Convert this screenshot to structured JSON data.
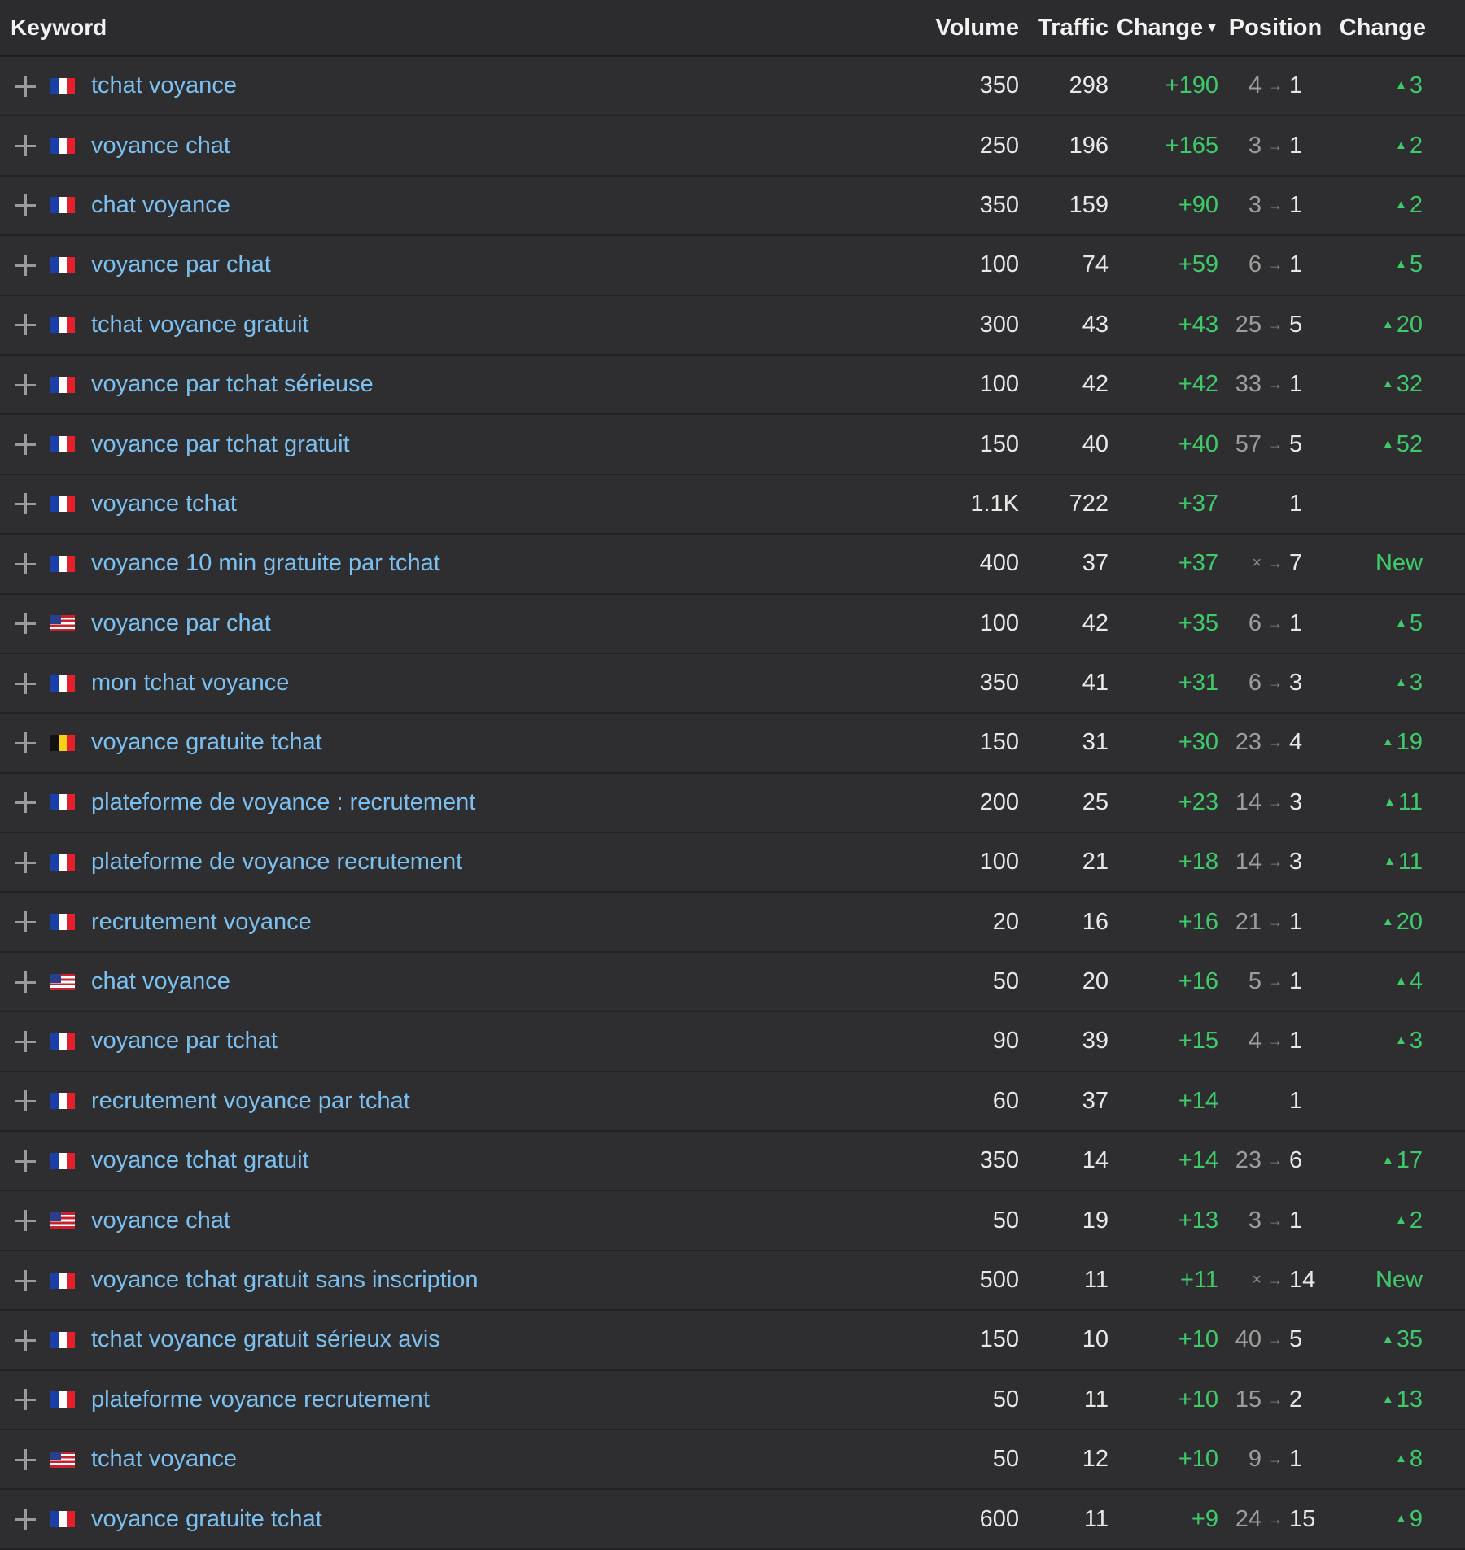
{
  "header": {
    "keyword": "Keyword",
    "volume": "Volume",
    "traffic": "Traffic",
    "change": "Change",
    "position": "Position",
    "position_change": "Change"
  },
  "rows": [
    {
      "flag": "fr",
      "keyword": "tchat voyance",
      "volume": "350",
      "traffic": "298",
      "change": "+190",
      "pos_from": "4",
      "pos_to": "1",
      "pos_change": "3"
    },
    {
      "flag": "fr",
      "keyword": "voyance chat",
      "volume": "250",
      "traffic": "196",
      "change": "+165",
      "pos_from": "3",
      "pos_to": "1",
      "pos_change": "2"
    },
    {
      "flag": "fr",
      "keyword": "chat voyance",
      "volume": "350",
      "traffic": "159",
      "change": "+90",
      "pos_from": "3",
      "pos_to": "1",
      "pos_change": "2"
    },
    {
      "flag": "fr",
      "keyword": "voyance par chat",
      "volume": "100",
      "traffic": "74",
      "change": "+59",
      "pos_from": "6",
      "pos_to": "1",
      "pos_change": "5"
    },
    {
      "flag": "fr",
      "keyword": "tchat voyance gratuit",
      "volume": "300",
      "traffic": "43",
      "change": "+43",
      "pos_from": "25",
      "pos_to": "5",
      "pos_change": "20"
    },
    {
      "flag": "fr",
      "keyword": "voyance par tchat sérieuse",
      "volume": "100",
      "traffic": "42",
      "change": "+42",
      "pos_from": "33",
      "pos_to": "1",
      "pos_change": "32"
    },
    {
      "flag": "fr",
      "keyword": "voyance par tchat gratuit",
      "volume": "150",
      "traffic": "40",
      "change": "+40",
      "pos_from": "57",
      "pos_to": "5",
      "pos_change": "52"
    },
    {
      "flag": "fr",
      "keyword": "voyance tchat",
      "volume": "1.1K",
      "traffic": "722",
      "change": "+37",
      "pos_from": "",
      "pos_to": "1",
      "pos_change": ""
    },
    {
      "flag": "fr",
      "keyword": "voyance 10 min gratuite par tchat",
      "volume": "400",
      "traffic": "37",
      "change": "+37",
      "pos_from": "×",
      "pos_to": "7",
      "pos_change": "New"
    },
    {
      "flag": "us",
      "keyword": "voyance par chat",
      "volume": "100",
      "traffic": "42",
      "change": "+35",
      "pos_from": "6",
      "pos_to": "1",
      "pos_change": "5"
    },
    {
      "flag": "fr",
      "keyword": "mon tchat voyance",
      "volume": "350",
      "traffic": "41",
      "change": "+31",
      "pos_from": "6",
      "pos_to": "3",
      "pos_change": "3"
    },
    {
      "flag": "be",
      "keyword": "voyance gratuite tchat",
      "volume": "150",
      "traffic": "31",
      "change": "+30",
      "pos_from": "23",
      "pos_to": "4",
      "pos_change": "19"
    },
    {
      "flag": "fr",
      "keyword": "plateforme de voyance : recrutement",
      "volume": "200",
      "traffic": "25",
      "change": "+23",
      "pos_from": "14",
      "pos_to": "3",
      "pos_change": "11"
    },
    {
      "flag": "fr",
      "keyword": "plateforme de voyance recrutement",
      "volume": "100",
      "traffic": "21",
      "change": "+18",
      "pos_from": "14",
      "pos_to": "3",
      "pos_change": "11"
    },
    {
      "flag": "fr",
      "keyword": "recrutement voyance",
      "volume": "20",
      "traffic": "16",
      "change": "+16",
      "pos_from": "21",
      "pos_to": "1",
      "pos_change": "20"
    },
    {
      "flag": "us",
      "keyword": "chat voyance",
      "volume": "50",
      "traffic": "20",
      "change": "+16",
      "pos_from": "5",
      "pos_to": "1",
      "pos_change": "4"
    },
    {
      "flag": "fr",
      "keyword": "voyance par tchat",
      "volume": "90",
      "traffic": "39",
      "change": "+15",
      "pos_from": "4",
      "pos_to": "1",
      "pos_change": "3"
    },
    {
      "flag": "fr",
      "keyword": "recrutement voyance par tchat",
      "volume": "60",
      "traffic": "37",
      "change": "+14",
      "pos_from": "",
      "pos_to": "1",
      "pos_change": ""
    },
    {
      "flag": "fr",
      "keyword": "voyance tchat gratuit",
      "volume": "350",
      "traffic": "14",
      "change": "+14",
      "pos_from": "23",
      "pos_to": "6",
      "pos_change": "17"
    },
    {
      "flag": "us",
      "keyword": "voyance chat",
      "volume": "50",
      "traffic": "19",
      "change": "+13",
      "pos_from": "3",
      "pos_to": "1",
      "pos_change": "2"
    },
    {
      "flag": "fr",
      "keyword": "voyance tchat gratuit sans inscription",
      "volume": "500",
      "traffic": "11",
      "change": "+11",
      "pos_from": "×",
      "pos_to": "14",
      "pos_change": "New"
    },
    {
      "flag": "fr",
      "keyword": "tchat voyance gratuit sérieux avis",
      "volume": "150",
      "traffic": "10",
      "change": "+10",
      "pos_from": "40",
      "pos_to": "5",
      "pos_change": "35"
    },
    {
      "flag": "fr",
      "keyword": "plateforme voyance recrutement",
      "volume": "50",
      "traffic": "11",
      "change": "+10",
      "pos_from": "15",
      "pos_to": "2",
      "pos_change": "13"
    },
    {
      "flag": "us",
      "keyword": "tchat voyance",
      "volume": "50",
      "traffic": "12",
      "change": "+10",
      "pos_from": "9",
      "pos_to": "1",
      "pos_change": "8"
    },
    {
      "flag": "fr",
      "keyword": "voyance gratuite tchat",
      "volume": "600",
      "traffic": "11",
      "change": "+9",
      "pos_from": "24",
      "pos_to": "15",
      "pos_change": "9"
    }
  ]
}
